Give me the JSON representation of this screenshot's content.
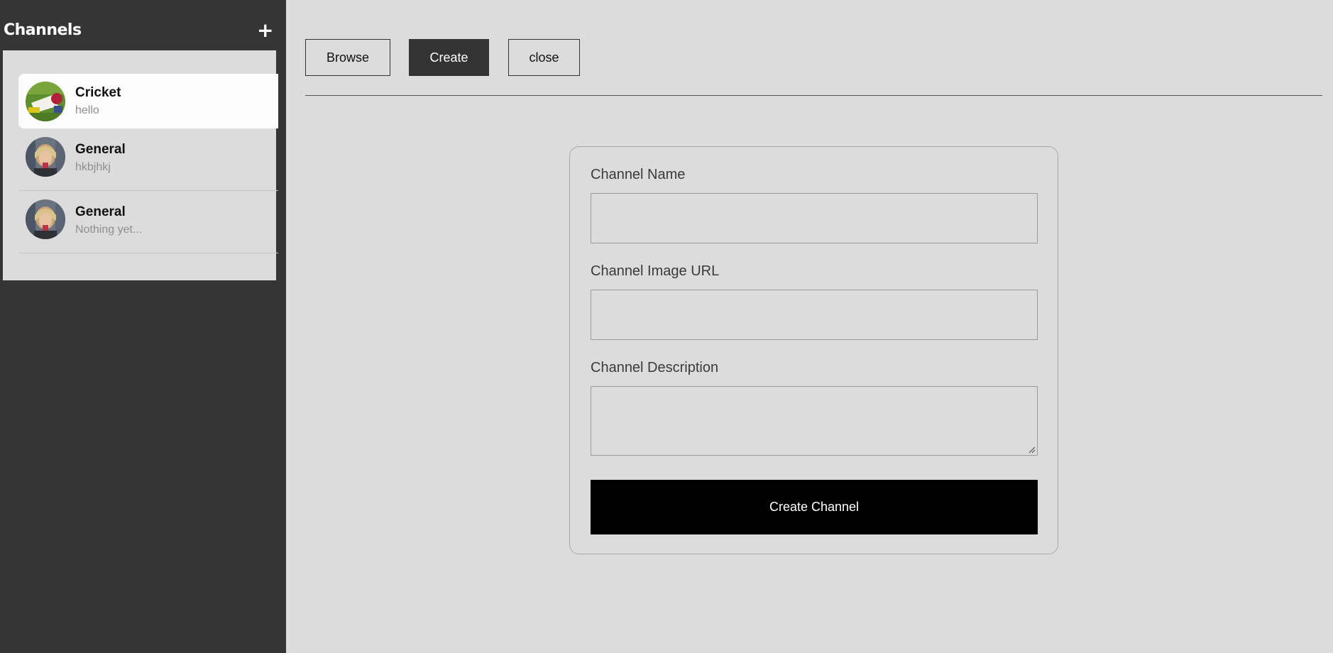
{
  "sidebar": {
    "title": "Channels",
    "add_icon": "plus-icon",
    "add_label": "+",
    "channels": [
      {
        "name": "Cricket",
        "last_message": "hello",
        "active": true
      },
      {
        "name": "General",
        "last_message": "hkbjhkj",
        "active": false
      },
      {
        "name": "General",
        "last_message": "Nothing yet...",
        "active": false
      }
    ]
  },
  "main": {
    "tabs": [
      {
        "label": "Browse",
        "selected": false
      },
      {
        "label": "Create",
        "selected": true
      },
      {
        "label": "close",
        "selected": false
      }
    ],
    "form": {
      "fields": [
        {
          "label": "Channel Name",
          "value": "",
          "type": "text"
        },
        {
          "label": "Channel Image URL",
          "value": "",
          "type": "text"
        },
        {
          "label": "Channel Description",
          "value": "",
          "type": "textarea"
        }
      ],
      "submit_label": "Create Channel"
    }
  },
  "colors": {
    "sidebar_bg": "#353535",
    "page_bg": "#dcdcdc",
    "selected_tab_bg": "#333333",
    "submit_bg": "#000000"
  }
}
